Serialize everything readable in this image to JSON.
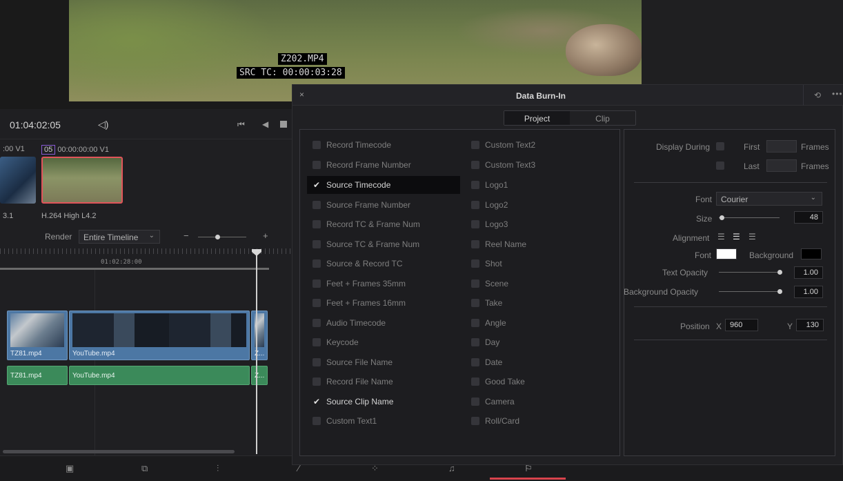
{
  "viewer": {
    "burn_clip_name": "Z202.MP4",
    "burn_timecode": "SRC TC: 00:00:03:28"
  },
  "timeline": {
    "timecode": "01:04:02:05",
    "clip_a_meta": ":00  V1",
    "clip_b_num": "05",
    "clip_b_meta": "00:00:00:00  V1",
    "clip_a_codec": "3.1",
    "clip_b_codec": "H.264 High L4.2",
    "render_label": "Render",
    "render_value": "Entire Timeline",
    "ruler_tc": "01:02:28:00",
    "video_clips": [
      {
        "label": "TZ81.mp4"
      },
      {
        "label": "YouTube.mp4"
      },
      {
        "label": "Z..."
      }
    ],
    "audio_clips": [
      {
        "label": "TZ81.mp4"
      },
      {
        "label": "YouTube.mp4"
      },
      {
        "label": "Z..."
      }
    ]
  },
  "dialog": {
    "title": "Data Burn-In",
    "close_glyph": "×",
    "reset_glyph": "⟲",
    "more_glyph": "•••",
    "tabs": [
      {
        "label": "Project",
        "active": true
      },
      {
        "label": "Clip",
        "active": false
      }
    ],
    "options_left": [
      {
        "label": "Record Timecode",
        "checked": false
      },
      {
        "label": "Record Frame Number",
        "checked": false
      },
      {
        "label": "Source Timecode",
        "checked": true
      },
      {
        "label": "Source Frame Number",
        "checked": false
      },
      {
        "label": "Record TC & Frame Num",
        "checked": false
      },
      {
        "label": "Source TC & Frame Num",
        "checked": false
      },
      {
        "label": "Source & Record TC",
        "checked": false
      },
      {
        "label": "Feet + Frames 35mm",
        "checked": false
      },
      {
        "label": "Feet + Frames 16mm",
        "checked": false
      },
      {
        "label": "Audio Timecode",
        "checked": false
      },
      {
        "label": "Keycode",
        "checked": false
      },
      {
        "label": "Source File Name",
        "checked": false
      },
      {
        "label": "Record File Name",
        "checked": false
      },
      {
        "label": "Source Clip Name",
        "checked": true
      },
      {
        "label": "Custom Text1",
        "checked": false
      }
    ],
    "options_right": [
      {
        "label": "Custom Text2",
        "checked": false
      },
      {
        "label": "Custom Text3",
        "checked": false
      },
      {
        "label": "Logo1",
        "checked": false
      },
      {
        "label": "Logo2",
        "checked": false
      },
      {
        "label": "Logo3",
        "checked": false
      },
      {
        "label": "Reel Name",
        "checked": false
      },
      {
        "label": "Shot",
        "checked": false
      },
      {
        "label": "Scene",
        "checked": false
      },
      {
        "label": "Take",
        "checked": false
      },
      {
        "label": "Angle",
        "checked": false
      },
      {
        "label": "Day",
        "checked": false
      },
      {
        "label": "Date",
        "checked": false
      },
      {
        "label": "Good Take",
        "checked": false
      },
      {
        "label": "Camera",
        "checked": false
      },
      {
        "label": "Roll/Card",
        "checked": false
      }
    ],
    "settings": {
      "display_during": "Display During",
      "first": "First",
      "last": "Last",
      "frames": "Frames",
      "font_label": "Font",
      "font_value": "Courier",
      "size_label": "Size",
      "size_value": "48",
      "alignment_label": "Alignment",
      "font_color_label": "Font",
      "background_label": "Background",
      "text_opacity_label": "Text Opacity",
      "text_opacity_value": "1.00",
      "bg_opacity_label": "Background Opacity",
      "bg_opacity_value": "1.00",
      "position_label": "Position",
      "x_label": "X",
      "x_value": "960",
      "y_label": "Y",
      "y_value": "130",
      "font_color": "#ffffff",
      "background_color": "#000000"
    }
  },
  "colors": {
    "accent_red": "#d9434c",
    "video_clip": "#4c77a4",
    "audio_clip": "#3b8a5a"
  }
}
